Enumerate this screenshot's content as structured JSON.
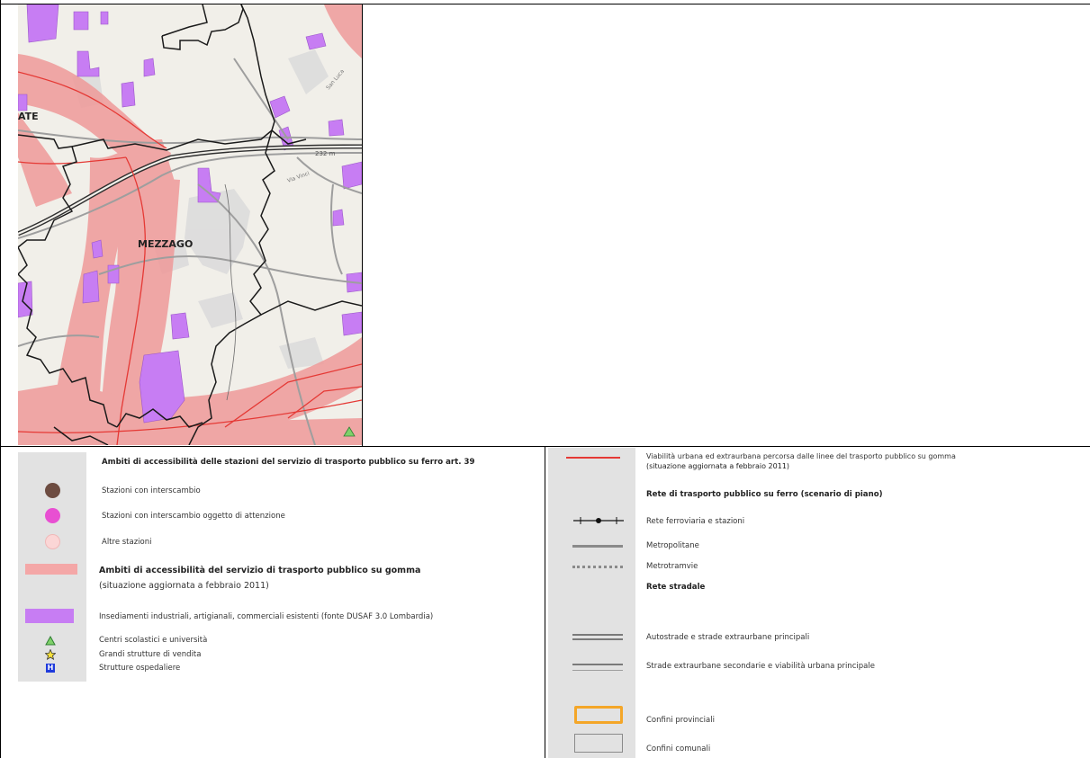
{
  "map": {
    "town_label": "MEZZAGO",
    "partial_label": "ATE",
    "elevation_label": "232 m",
    "street_label": "Via Vinci",
    "street_label_2": "San Luca",
    "symbol_colors": {
      "pt_buffer": "#ef9a9a",
      "industrial": "#c77df3",
      "municipal_boundary": "#1a1a1a",
      "bus_line": "#e53935",
      "railway": "#2e2e2e"
    }
  },
  "legend_left": {
    "rail_title": "Ambiti di accessibilità delle stazioni del servizio di trasporto pubblico su ferro  art. 39",
    "stations_interchange": "Stazioni con interscambio",
    "stations_attention": "Stazioni con interscambio oggetto di attenzione",
    "other_stations": "Altre stazioni",
    "bus_title": "Ambiti di accessibilità del servizio di trasporto pubblico su gomma",
    "bus_subtitle": "(situazione aggiornata a febbraio 2011)",
    "industrial": "Insediamenti industriali, artigianali, commerciali esistenti (fonte DUSAF 3.0 Lombardia)",
    "schools": "Centri scolastici e università",
    "retail": "Grandi strutture di vendita",
    "hospitals": "Strutture ospedaliere",
    "hospital_glyph": "H",
    "colors": {
      "interchange": "#6d4c41",
      "attention": "#e84fd2",
      "other": "#fbd6d6",
      "bus_band": "#f4a7a7",
      "industrial": "#c77df3"
    }
  },
  "legend_right": {
    "bus_routes_line1": "Viabilità urbana ed extraurbana percorsa dalle linee del trasporto pubblico su gomma",
    "bus_routes_line2": "(situazione aggiornata a febbraio 2011)",
    "rail_network_title": "Rete di trasporto pubblico su ferro (scenario di piano)",
    "railway": "Rete ferroviaria e stazioni",
    "metro": "Metropolitane",
    "tram": "Metrotramvie",
    "road_title": "Rete stradale",
    "highways": "Autostrade e strade extraurbane principali",
    "secondary_roads": "Strade extraurbane secondarie e viabilità urbana principale",
    "provincial_borders": "Confini provinciali",
    "municipal_borders": "Confini comunali",
    "colors": {
      "bus_line": "#e53935",
      "provincial": "#f4a628",
      "municipal": "#9e9e9e"
    }
  }
}
